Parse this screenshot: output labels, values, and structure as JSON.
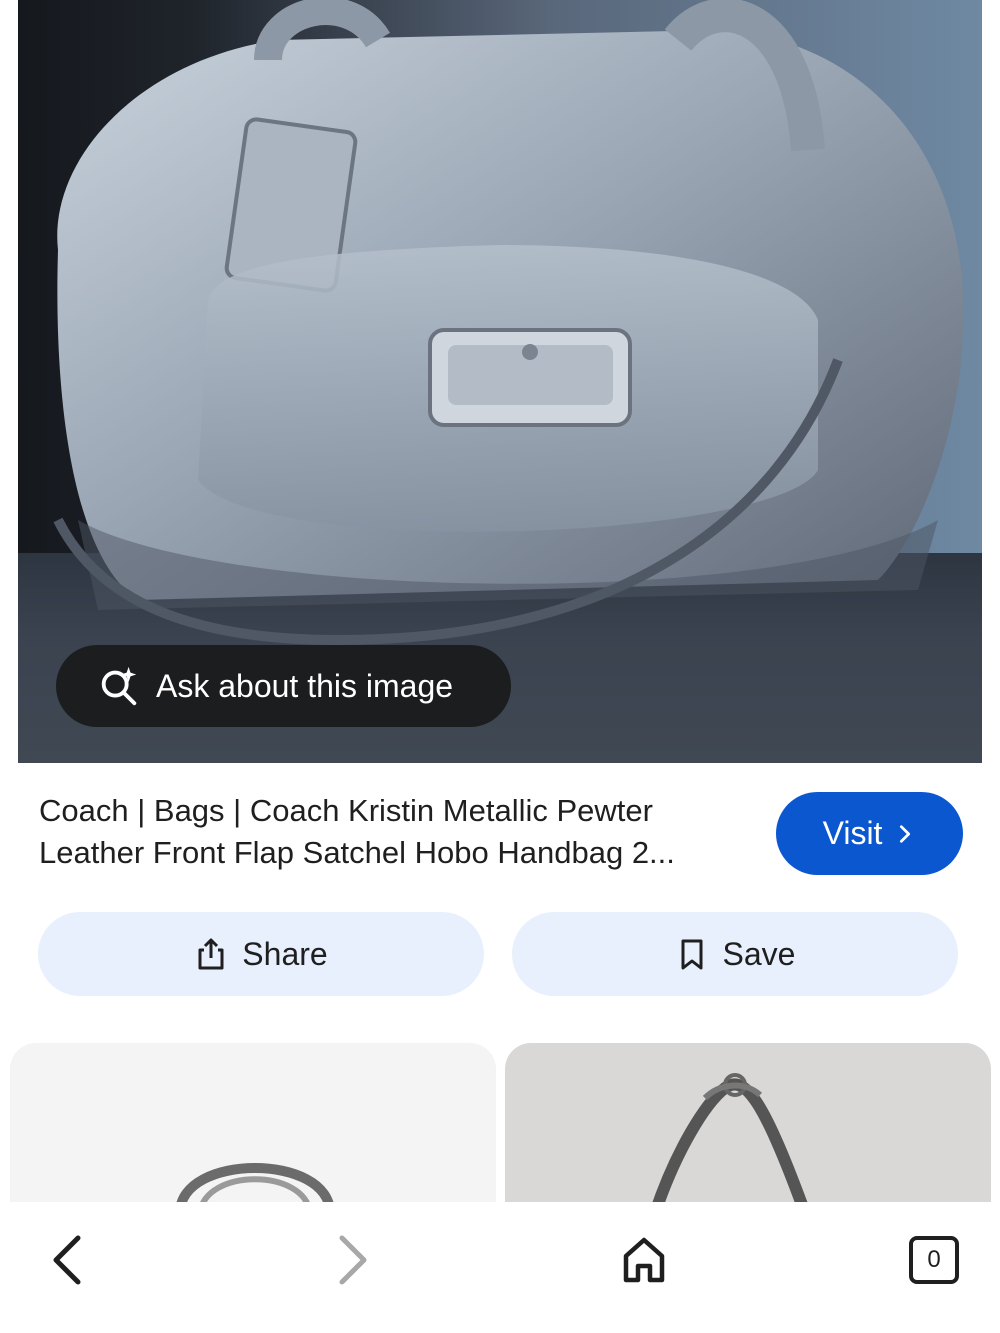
{
  "image_overlay": {
    "ask_label": "Ask about this image"
  },
  "result": {
    "title": "Coach | Bags | Coach Kristin Metallic Pewter Leather Front Flap Satchel Hobo Handbag 2...",
    "visit_label": "Visit"
  },
  "actions": {
    "share_label": "Share",
    "save_label": "Save"
  },
  "bottom_nav": {
    "tabs_count": "0"
  },
  "colors": {
    "visit_button": "#0b57d0",
    "action_button_bg": "#e8f0fd",
    "pill_bg": "#1c1d1f"
  }
}
